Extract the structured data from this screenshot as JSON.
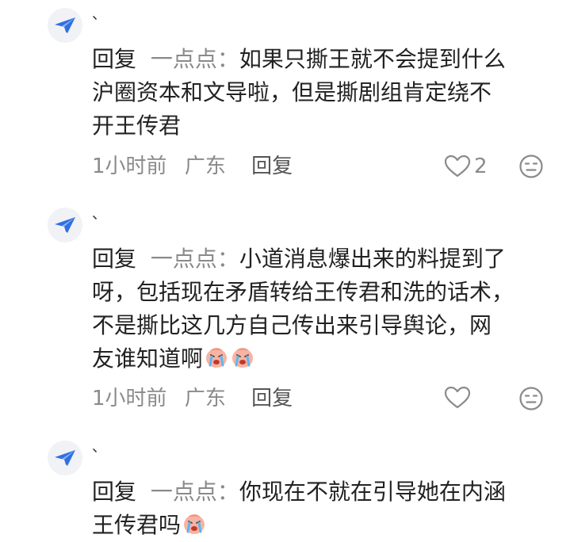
{
  "comments": [
    {
      "username": "、",
      "reply_prefix": "回复",
      "reply_target": "一点点",
      "reply_colon": "：",
      "text": "如果只撕王就不会提到什么\n沪圈资本和文导啦，但是撕剧组肯定绕不\n开王传君",
      "emoji_count": 0,
      "time": "1小时前",
      "location": "广东",
      "reply_label": "回复",
      "like_count": "2"
    },
    {
      "username": "、",
      "reply_prefix": "回复",
      "reply_target": "一点点",
      "reply_colon": "：",
      "text": "小道消息爆出来的料提到了\n呀，包括现在矛盾转给王传君和洗的话术，\n不是撕比这几方自己传出来引导舆论，网\n友谁知道啊",
      "emoji_count": 2,
      "time": "1小时前",
      "location": "广东",
      "reply_label": "回复",
      "like_count": ""
    },
    {
      "username": "、",
      "reply_prefix": "回复",
      "reply_target": "一点点",
      "reply_colon": "：",
      "text": "你现在不就在引导她在内涵\n王传君吗",
      "emoji_count": 1
    }
  ],
  "icons": {
    "avatar": "paper-plane-icon",
    "like": "heart-outline-icon",
    "dislike": "meh-face-icon",
    "emoji": "crying-face-emoji"
  },
  "colors": {
    "text": "#222222",
    "muted": "#8a8a8a",
    "avatar_bg": "#f1f2f6",
    "plane": "#2f6fe4"
  }
}
